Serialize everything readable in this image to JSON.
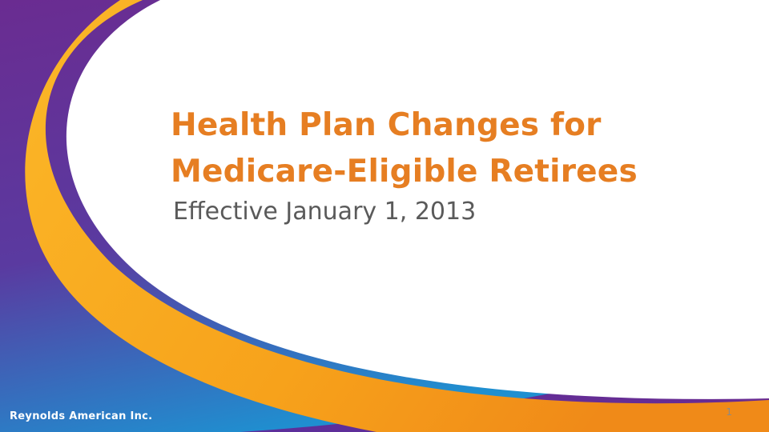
{
  "slide": {
    "title_line_1": "Health Plan Changes for",
    "title_line_2": "Medicare-Eligible Retirees",
    "subtitle": "Effective January 1, 2013",
    "company": "Reynolds American Inc.",
    "page_number": "1"
  },
  "colors": {
    "title": "#e67e22",
    "subtitle": "#5a5a5a",
    "purple": "#6a2c91",
    "blue": "#2a7cc7",
    "orange": "#f7a21b",
    "page_number": "#8a8a8a"
  }
}
